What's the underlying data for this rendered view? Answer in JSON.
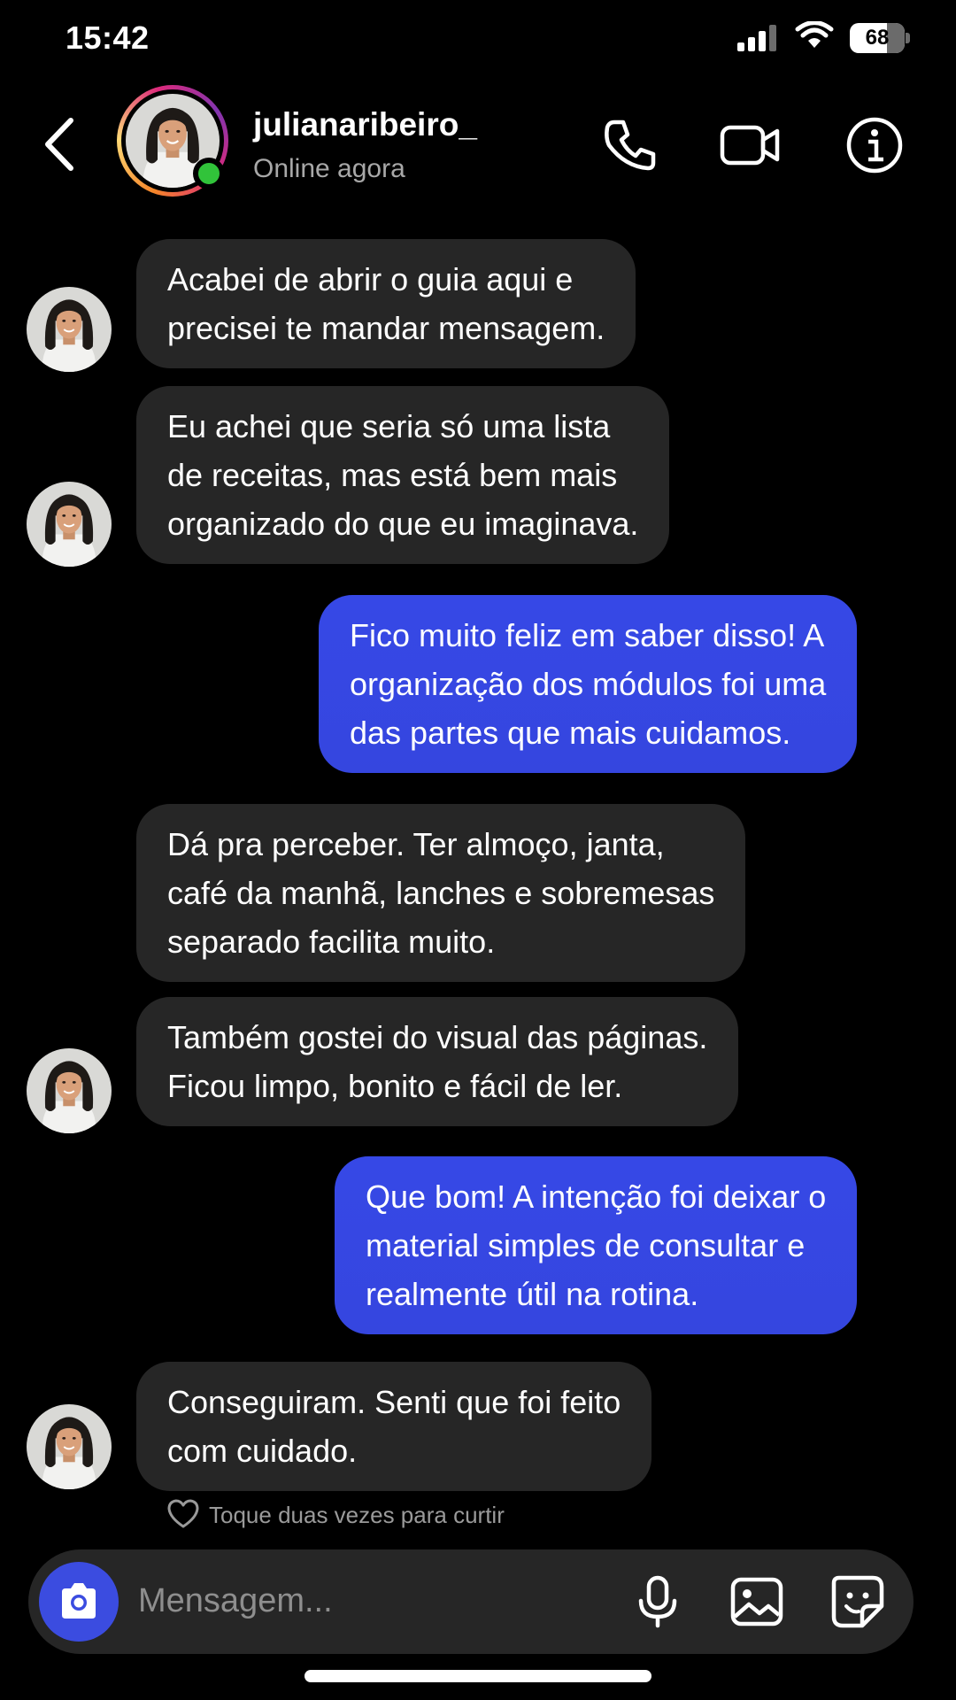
{
  "status_bar": {
    "time": "15:42",
    "battery_level": "68",
    "battery_fraction": 0.68
  },
  "header": {
    "username": "julianaribeiro_",
    "presence": "Online agora",
    "icons": [
      "back-icon",
      "phone-icon",
      "video-camera-icon",
      "info-icon"
    ]
  },
  "messages": [
    {
      "direction": "in",
      "text": "Acabei de abrir o guia aqui e\nprecisei te mandar mensagem."
    },
    {
      "direction": "in",
      "text": "Eu achei que seria só uma lista\nde receitas, mas está bem mais\norganizado do que eu imaginava."
    },
    {
      "direction": "out",
      "text": "Fico muito feliz em saber disso! A\norganização dos módulos foi uma\ndas partes que mais cuidamos."
    },
    {
      "direction": "in",
      "text": "Dá pra perceber. Ter almoço, janta,\ncafé da manhã, lanches e sobremesas\nseparado facilita muito."
    },
    {
      "direction": "in",
      "text": "Também gostei do visual das páginas.\nFicou limpo, bonito e fácil de ler."
    },
    {
      "direction": "out",
      "text": "Que bom! A intenção foi deixar o\nmaterial simples de consultar e\nrealmente útil na rotina."
    },
    {
      "direction": "in",
      "text": "Conseguiram. Senti que foi feito\ncom cuidado."
    }
  ],
  "like_hint": "Toque duas vezes para curtir",
  "composer": {
    "placeholder": "Mensagem...",
    "icons": [
      "camera-icon",
      "microphone-icon",
      "gallery-icon",
      "sticker-icon"
    ]
  },
  "colors": {
    "background": "#000000",
    "incoming_bubble": "#262626",
    "outgoing_bubble": "#3b4ce0",
    "online": "#31c33a",
    "secondary_text": "#a8a8a8"
  }
}
